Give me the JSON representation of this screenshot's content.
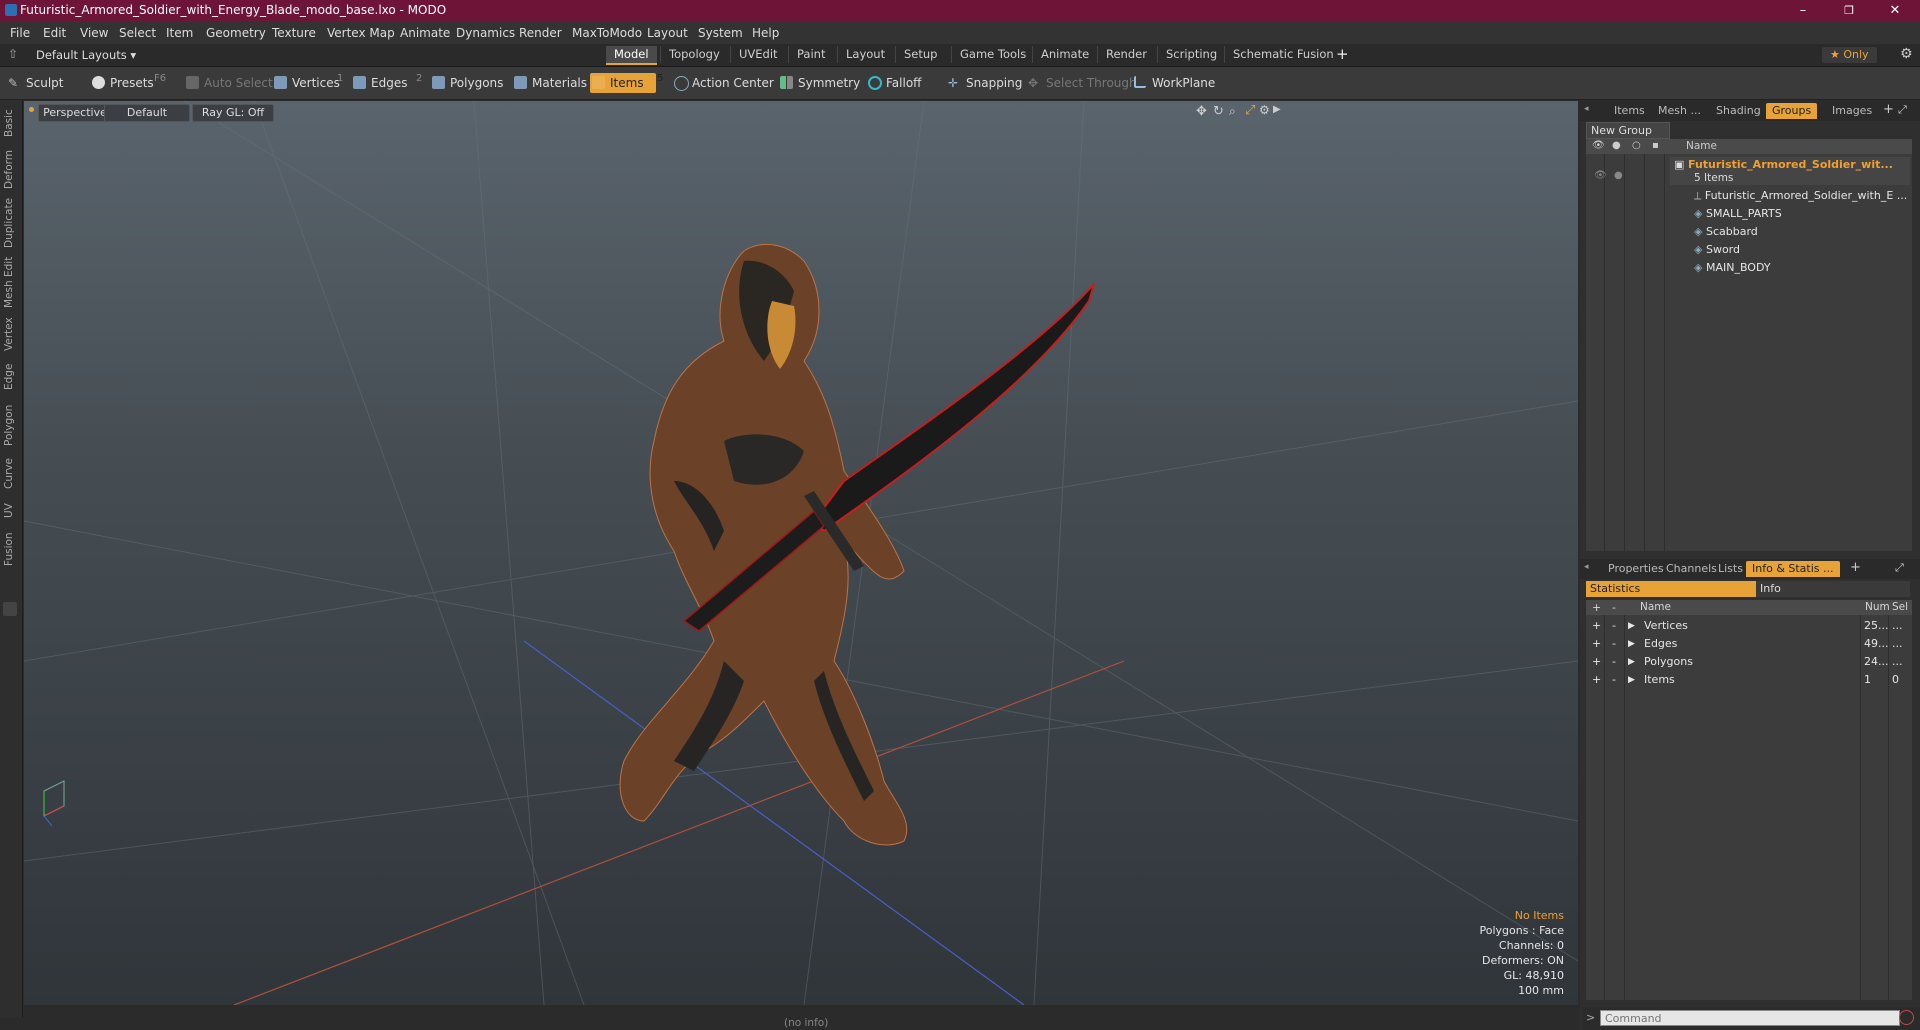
{
  "window": {
    "title": "Futuristic_Armored_Soldier_with_Energy_Blade_modo_base.lxo - MODO",
    "minimize": "–",
    "maximize": "❐",
    "close": "✕"
  },
  "menu": [
    "File",
    "Edit",
    "View",
    "Select",
    "Item",
    "Geometry",
    "Texture",
    "Vertex Map",
    "Animate",
    "Dynamics",
    "Render",
    "MaxToModo",
    "Layout",
    "System",
    "Help"
  ],
  "layouts": {
    "selector": "Default Layouts ▾",
    "tabs": [
      "Model",
      "Topology",
      "UVEdit",
      "Paint",
      "Layout",
      "Setup",
      "Game Tools",
      "Animate",
      "Render",
      "Scripting",
      "Schematic Fusion"
    ],
    "active": "Model",
    "add": "+",
    "only": "★  Only",
    "settings_icon": "gear-icon"
  },
  "toolbar": {
    "sculpt": "Sculpt",
    "presets": "Presets",
    "presets_key": "F6",
    "auto_select": "Auto Select",
    "vertices": "Vertices",
    "vertices_key": "1",
    "edges": "Edges",
    "edges_key": "2",
    "polygons": "Polygons",
    "materials": "Materials",
    "items": "Items",
    "items_key": "5",
    "action_center": "Action Center",
    "symmetry": "Symmetry",
    "falloff": "Falloff",
    "snapping": "Snapping",
    "select_through": "Select Through",
    "workplane": "WorkPlane"
  },
  "left_tabs": [
    "Basic",
    "Deform",
    "Duplicate",
    "Mesh Edit",
    "Vertex",
    "Edge",
    "Polygon",
    "Curve",
    "UV",
    "Fusion"
  ],
  "viewport": {
    "view": "Perspective",
    "shading": "Default",
    "raygl": "Ray GL: Off",
    "info": {
      "selection": "No Items",
      "polygons": "Polygons : Face",
      "channels": "Channels: 0",
      "deformers": "Deformers: ON",
      "gl": "GL: 48,910",
      "scale": "100 mm"
    },
    "status": "(no info)"
  },
  "groups_panel": {
    "tabs": [
      "Items",
      "Mesh ...",
      "Shading",
      "Groups",
      "Images"
    ],
    "active": "Groups",
    "add": "+",
    "new_group": "New Group",
    "column_name": "Name",
    "root": {
      "name": "Futuristic_Armored_Soldier_wit...",
      "count": "5 Items"
    },
    "children": [
      "Futuristic_Armored_Soldier_with_E ...",
      "SMALL_PARTS",
      "Scabbard",
      "Sword",
      "MAIN_BODY"
    ]
  },
  "stats_panel": {
    "tabs": [
      "Properties",
      "Channels",
      "Lists",
      "Info & Statis ..."
    ],
    "active": "Info & Statis ...",
    "add": "+",
    "subtabs": [
      "Statistics",
      "Info"
    ],
    "headers": {
      "plus": "+",
      "minus": "-",
      "name": "Name",
      "num": "Num",
      "sel": "Sel"
    },
    "rows": [
      {
        "name": "Vertices",
        "num": "25...",
        "sel": "..."
      },
      {
        "name": "Edges",
        "num": "49...",
        "sel": "..."
      },
      {
        "name": "Polygons",
        "num": "24...",
        "sel": "..."
      },
      {
        "name": "Items",
        "num": "1",
        "sel": "0"
      }
    ]
  },
  "command": {
    "prompt": ">",
    "placeholder": "Command"
  },
  "colors": {
    "titlebar": "#6d1437",
    "accent": "#e8a338",
    "selected_text": "#f0a030"
  }
}
